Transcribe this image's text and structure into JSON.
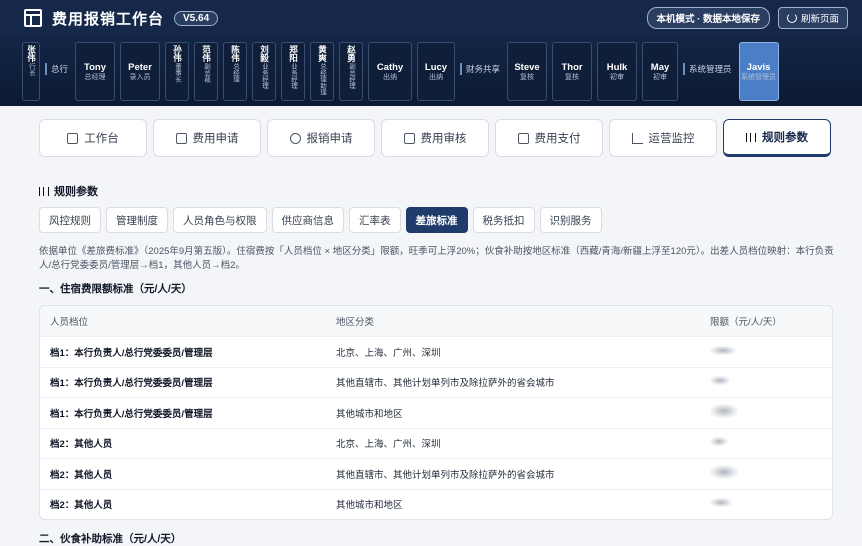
{
  "header": {
    "title": "费用报销工作台",
    "version": "V5.64",
    "mode_badge": "本机模式 · 数据本地保存",
    "refresh_label": "刷新页面"
  },
  "roles": {
    "partial_first": {
      "name": "张伟",
      "sub": "行长"
    },
    "group_head_office": "总行",
    "head_office": [
      {
        "name": "Tony",
        "sub": "总经理"
      },
      {
        "name": "Peter",
        "sub": "录入员"
      },
      {
        "name": "孙伟",
        "sub": "董事长"
      },
      {
        "name": "范伟",
        "sub": "副总裁"
      },
      {
        "name": "陈伟",
        "sub": "总经理"
      },
      {
        "name": "刘毅",
        "sub": "业务经理"
      },
      {
        "name": "郑阳",
        "sub": "业务经理"
      },
      {
        "name": "黄爽",
        "sub": "总经理助理"
      },
      {
        "name": "赵勇",
        "sub": "副总经理"
      },
      {
        "name": "Cathy",
        "sub": "出纳"
      },
      {
        "name": "Lucy",
        "sub": "出纳"
      }
    ],
    "group_shared": "财务共享",
    "shared": [
      {
        "name": "Steve",
        "sub": "复核"
      },
      {
        "name": "Thor",
        "sub": "复核"
      },
      {
        "name": "Hulk",
        "sub": "初审"
      },
      {
        "name": "May",
        "sub": "初审"
      }
    ],
    "group_admin": "系统管理员",
    "admin": {
      "name": "Javis",
      "sub": "系统管理员"
    }
  },
  "tabs": [
    {
      "label": "工作台",
      "icon": "home-icon"
    },
    {
      "label": "费用申请",
      "icon": "document-icon"
    },
    {
      "label": "报销申请",
      "icon": "check-circle-icon"
    },
    {
      "label": "费用审核",
      "icon": "layers-icon"
    },
    {
      "label": "费用支付",
      "icon": "card-icon"
    },
    {
      "label": "运营监控",
      "icon": "chart-icon"
    },
    {
      "label": "规则参数",
      "icon": "sliders-icon",
      "active": true
    }
  ],
  "section_title": "规则参数",
  "subtabs": [
    {
      "label": "风控规则"
    },
    {
      "label": "管理制度"
    },
    {
      "label": "人员角色与权限"
    },
    {
      "label": "供应商信息"
    },
    {
      "label": "汇率表"
    },
    {
      "label": "差旅标准",
      "active": true
    },
    {
      "label": "税务抵扣"
    },
    {
      "label": "识别服务"
    }
  ],
  "description": "依据单位《差旅费标准》（2025年9月第五版）。住宿费按「人员档位 × 地区分类」限额，旺季可上浮20%；伙食补助按地区标准（西藏/青海/新疆上浮至120元）。出差人员档位映射：本行负责人/总行党委委员/管理层→档1，其他人员→档2。",
  "lodging": {
    "heading": "一、住宿费限额标准（元/人/天）",
    "columns": [
      "人员档位",
      "地区分类",
      "限额（元/人/天）"
    ],
    "rows": [
      {
        "tier": "档1：本行负责人/总行党委委员/管理层",
        "region": "北京、上海、广州、深圳"
      },
      {
        "tier": "档1：本行负责人/总行党委委员/管理层",
        "region": "其他直辖市、其他计划单列市及除拉萨外的省会城市"
      },
      {
        "tier": "档1：本行负责人/总行党委委员/管理层",
        "region": "其他城市和地区"
      },
      {
        "tier": "档2：其他人员",
        "region": "北京、上海、广州、深圳"
      },
      {
        "tier": "档2：其他人员",
        "region": "其他直辖市、其他计划单列市及除拉萨外的省会城市"
      },
      {
        "tier": "档2：其他人员",
        "region": "其他城市和地区"
      }
    ]
  },
  "meal": {
    "heading": "二、伙食补助标准（元/人/天）"
  }
}
